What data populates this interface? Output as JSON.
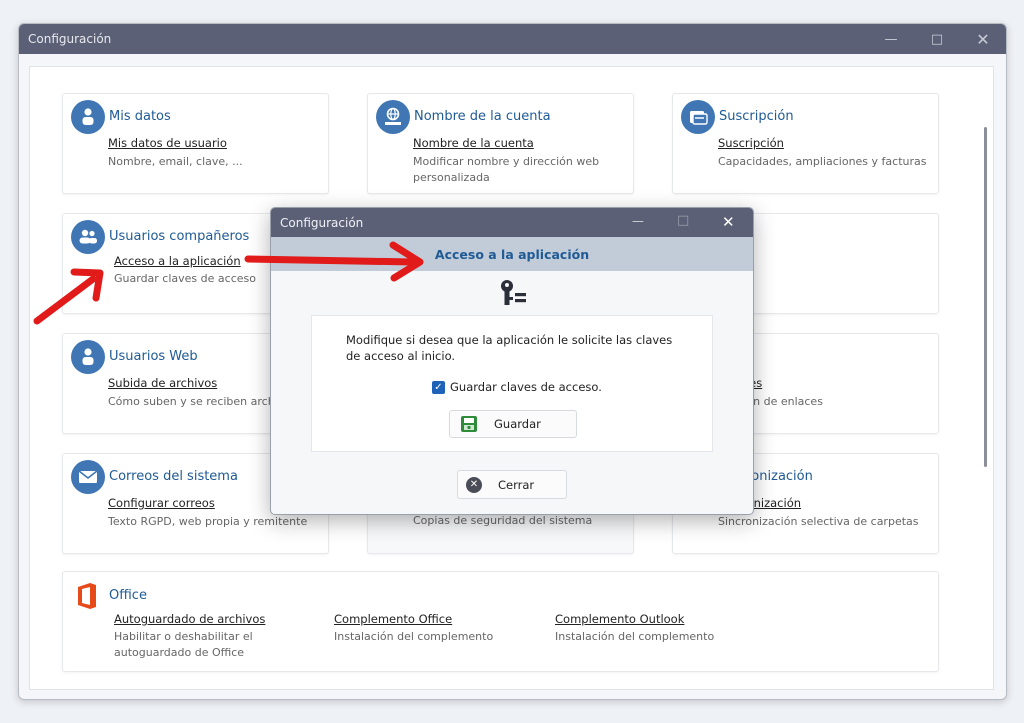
{
  "window": {
    "title": "Configuración"
  },
  "cards": [
    {
      "title": "Mis datos",
      "link": "Mis datos de usuario",
      "desc": "Nombre, email, clave, ...",
      "icon": "user-icon"
    },
    {
      "title": "Nombre de la cuenta",
      "link": "Nombre de la cuenta",
      "desc": "Modificar nombre y dirección web personalizada",
      "icon": "globe-icon"
    },
    {
      "title": "Suscripción",
      "link": "Suscripción",
      "desc": "Capacidades, ampliaciones y facturas",
      "icon": "subscription-icon"
    },
    {
      "title": "Usuarios compañeros",
      "link": "Acceso a la aplicación",
      "desc": "Guardar claves de acceso",
      "icon": "users-icon"
    },
    {
      "title": "Usuarios Web",
      "link": "Subida de archivos",
      "desc": "Cómo suben y se reciben archivos",
      "icon": "user-icon"
    },
    {
      "link": "Enlaces",
      "desc": "Gestión de enlaces",
      "icon": ""
    },
    {
      "title": "Correos del sistema",
      "link": "Configurar correos",
      "desc": "Texto RGPD, web propia y remitente",
      "icon": "mail-icon"
    },
    {
      "desc": "Copias de seguridad del sistema"
    },
    {
      "title": "Sincronización",
      "link": "Sincronización",
      "desc": "Sincronización selectiva de carpetas"
    }
  ],
  "office": {
    "title": "Office",
    "items": [
      {
        "link": "Autoguardado de archivos",
        "desc": "Habilitar o deshabilitar el autoguardado de Office"
      },
      {
        "link": "Complemento Office",
        "desc": "Instalación del complemento"
      },
      {
        "link": "Complemento Outlook",
        "desc": "Instalación del complemento"
      }
    ]
  },
  "dialog": {
    "title": "Configuración",
    "header": "Acceso a la aplicación",
    "message": "Modifique si desea que la aplicación le solicite las claves de acceso al inicio.",
    "checkbox_label": "Guardar claves de acceso.",
    "checkbox_checked": true,
    "save_label": "Guardar",
    "close_label": "Cerrar"
  },
  "colors": {
    "accent": "#1f5a94",
    "icon_bg": "#3f76b3",
    "titlebar": "#5c6076",
    "arrow": "#e11a1a",
    "office": "#e64a19"
  }
}
